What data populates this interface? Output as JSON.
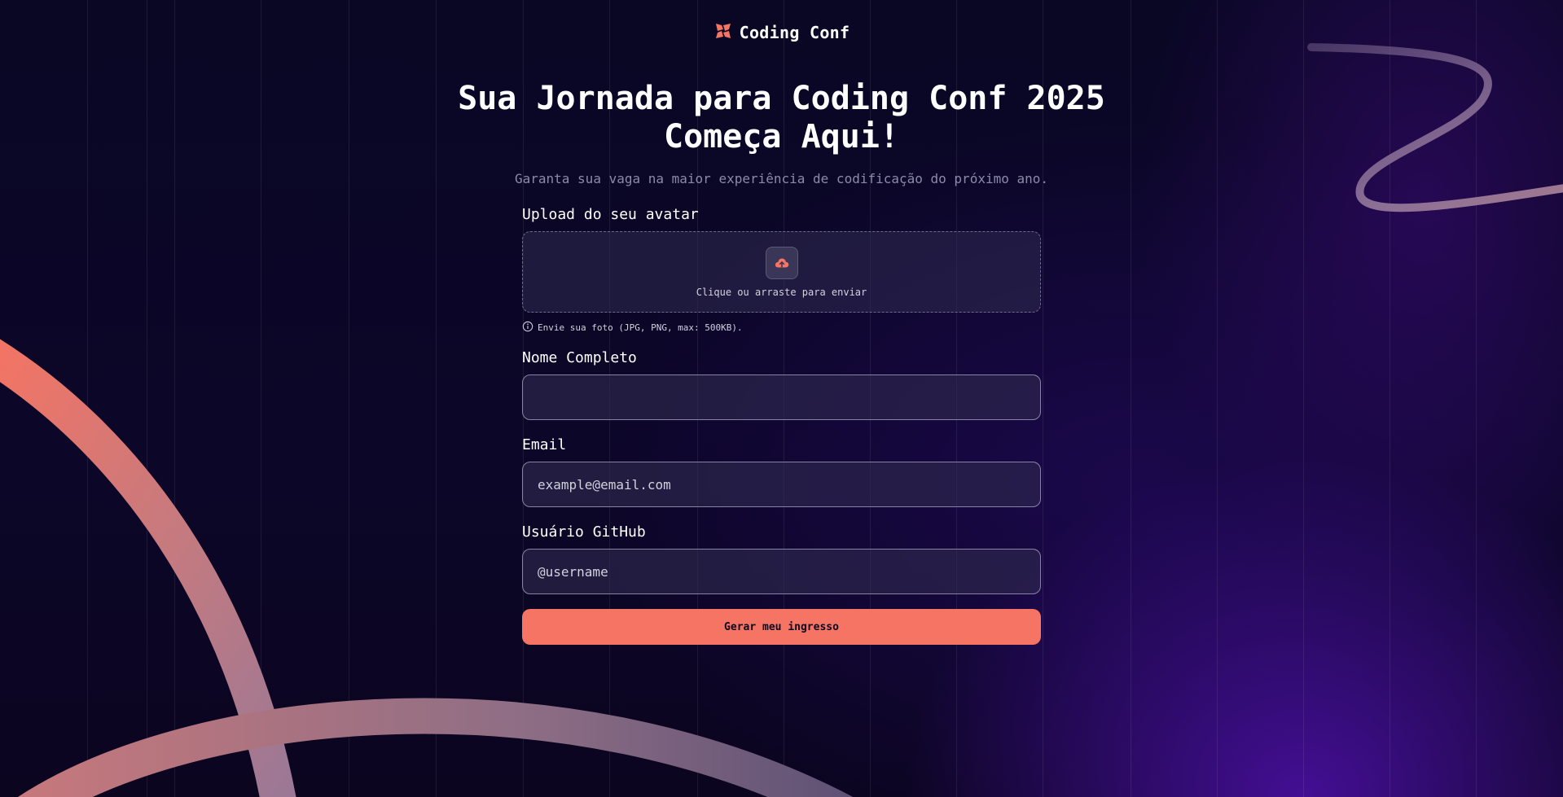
{
  "brand": {
    "name": "Coding Conf",
    "accent": "#f57463",
    "icon": "coding-conf-logo-icon"
  },
  "hero": {
    "title": "Sua Jornada para Coding Conf 2025 Começa Aqui!",
    "subtitle": "Garanta sua vaga na maior experiência de codificação do próximo ano."
  },
  "form": {
    "avatar": {
      "label": "Upload do seu avatar",
      "dropzone_text": "Clique ou arraste para enviar",
      "hint": "Envie sua foto (JPG, PNG, max: 500KB).",
      "icon": "upload-cloud-icon"
    },
    "full_name": {
      "label": "Nome Completo",
      "value": "",
      "placeholder": ""
    },
    "email": {
      "label": "Email",
      "value": "",
      "placeholder": "example@email.com"
    },
    "github": {
      "label": "Usuário GitHub",
      "value": "",
      "placeholder": "@username"
    },
    "submit_label": "Gerar meu ingresso"
  },
  "colors": {
    "background": "#0b0720",
    "input_background": "#2a2645",
    "button": "#f57463",
    "muted_text": "#8c8aa8"
  }
}
